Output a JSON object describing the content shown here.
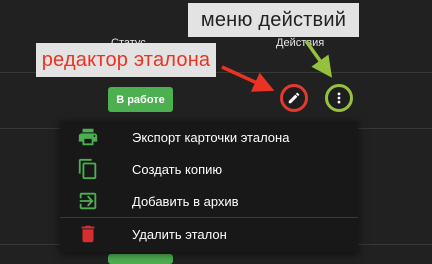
{
  "table": {
    "status_header": "Статус",
    "actions_header": "Действия",
    "status_badge": "В работе"
  },
  "annotations": {
    "actions_menu": "меню действий",
    "etalon_editor": "редактор эталона"
  },
  "menu": {
    "items": [
      {
        "label": "Экспорт карточки эталона",
        "icon": "printer-icon"
      },
      {
        "label": "Создать копию",
        "icon": "copy-icon"
      },
      {
        "label": "Добавить в архив",
        "icon": "archive-icon"
      },
      {
        "label": "Удалить эталон",
        "icon": "trash-icon"
      }
    ]
  },
  "colors": {
    "background": "#212121",
    "accent_green": "#4caf50",
    "annotation_red": "#ea3323",
    "annotation_green": "#95c13d",
    "delete_red": "#d32f2f"
  }
}
